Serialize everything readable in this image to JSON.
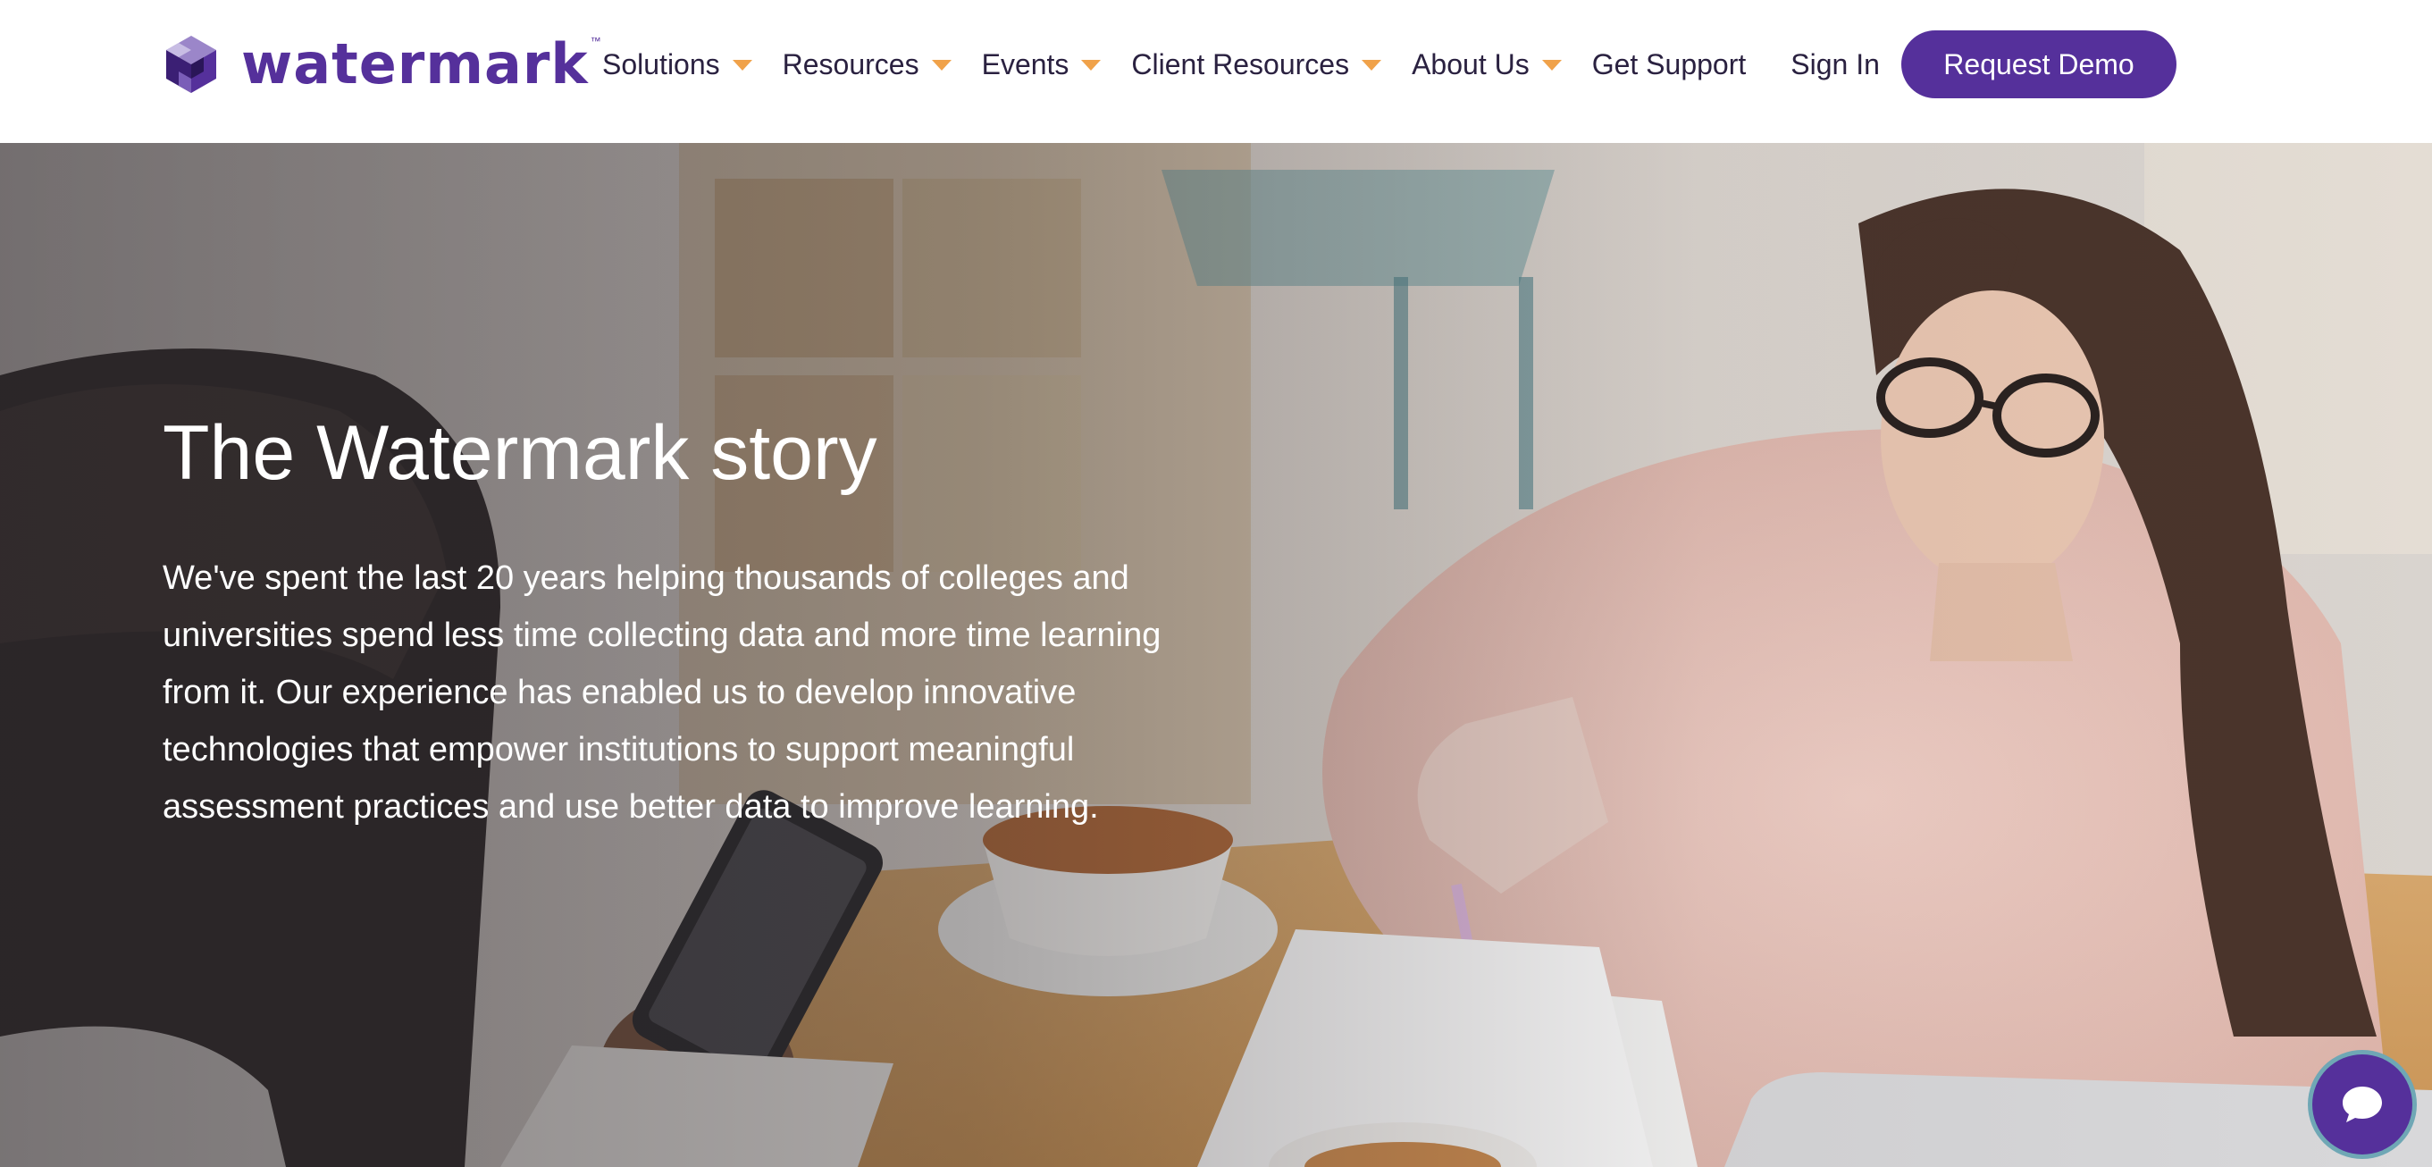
{
  "brand": {
    "name": "watermark",
    "trademark": "™",
    "color": "#55309b"
  },
  "nav": {
    "items": [
      {
        "label": "Solutions",
        "icon": "caret-down-icon"
      },
      {
        "label": "Resources",
        "icon": "caret-down-icon"
      },
      {
        "label": "Events",
        "icon": "caret-down-icon"
      },
      {
        "label": "Client Resources",
        "icon": "caret-down-icon"
      },
      {
        "label": "About Us",
        "icon": "caret-down-icon"
      }
    ],
    "get_support": "Get Support",
    "sign_in": "Sign In",
    "request_demo": "Request Demo",
    "caret_color": "#f0a24a"
  },
  "hero": {
    "title": "The Watermark story",
    "body": "We've spent the last 20 years helping thousands of colleges and universities spend less time collecting data and more time learning from it. Our experience has enabled us to develop innovative technologies that empower institutions to support meaningful assessment practices and use better data to improve learning."
  },
  "chat": {
    "icon": "chat-bubble-icon"
  }
}
